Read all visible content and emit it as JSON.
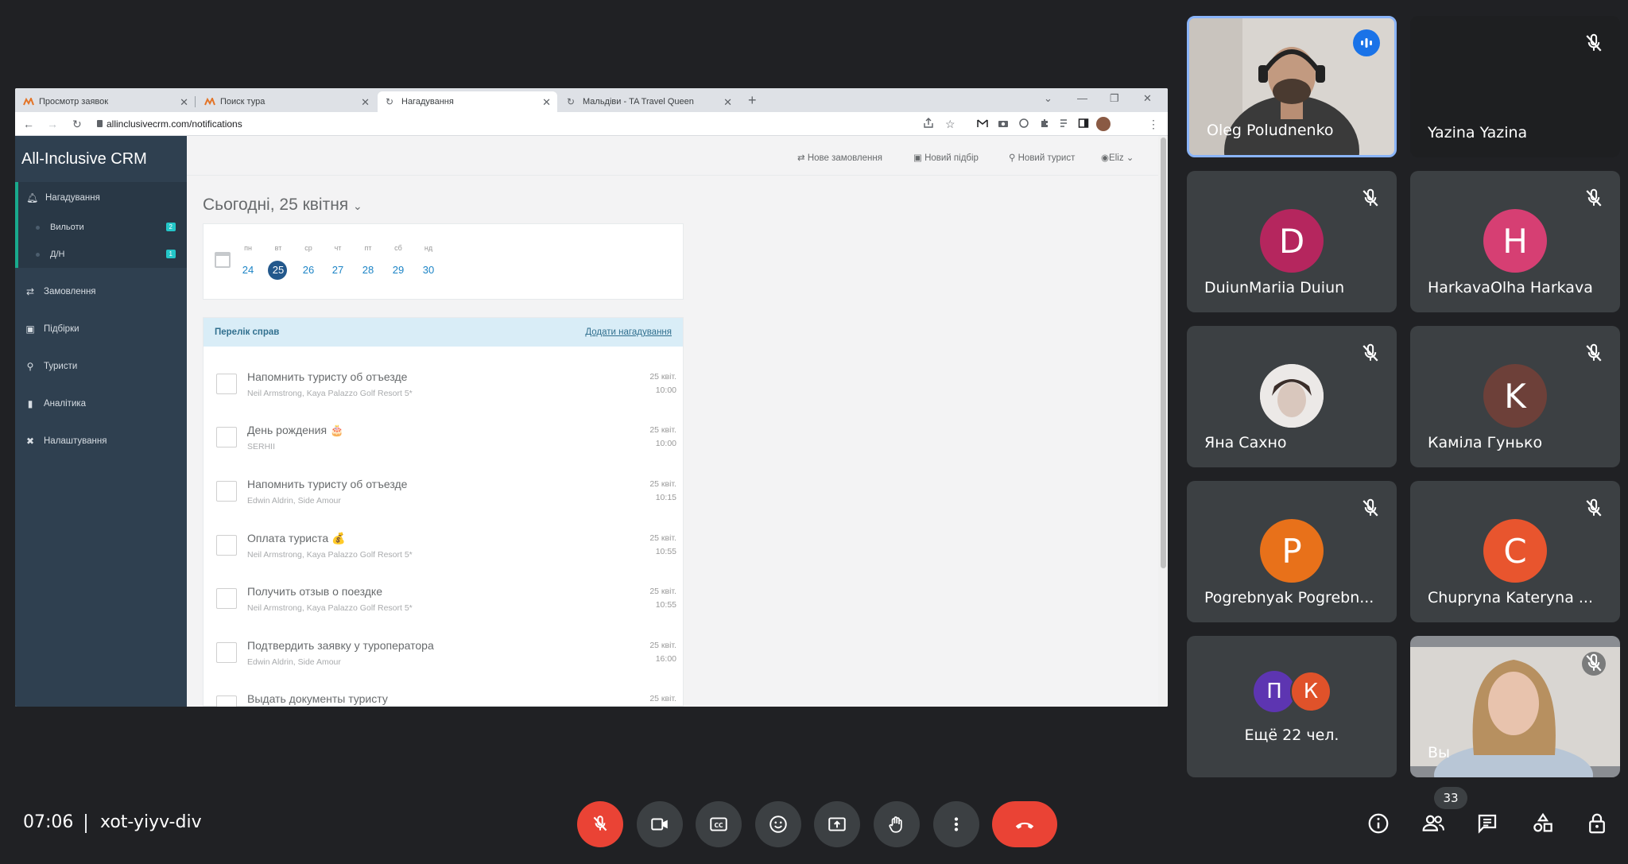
{
  "browser": {
    "tabs": [
      {
        "label": "Просмотр заявок"
      },
      {
        "label": "Поиск тура"
      },
      {
        "label": "Нагадування"
      },
      {
        "label": "Мальдіви - TA Travel Queen"
      }
    ],
    "url": "allinclusivecrm.com/notifications"
  },
  "app": {
    "brand": "All-Inclusive CRM",
    "sidebar": {
      "items": [
        {
          "label": "Нагадування",
          "icon": "bell-icon"
        },
        {
          "label": "Замовлення",
          "icon": "handshake-icon"
        },
        {
          "label": "Підбірки",
          "icon": "folder-icon"
        },
        {
          "label": "Туристи",
          "icon": "walker-icon"
        },
        {
          "label": "Аналітика",
          "icon": "bar-chart-icon"
        },
        {
          "label": "Налаштування",
          "icon": "tools-icon"
        }
      ],
      "subitems": [
        {
          "label": "Вильоти",
          "badge": "2"
        },
        {
          "label": "Д/Н",
          "badge": "1"
        }
      ]
    },
    "topnav": {
      "new_order": "Нове замовлення",
      "new_selection": "Новий підбір",
      "new_tourist": "Новий турист",
      "user": "Eliz"
    },
    "date_title": "Сьогодні, 25 квітня",
    "week": {
      "days": [
        "пн",
        "вт",
        "ср",
        "чт",
        "пт",
        "сб",
        "нд"
      ],
      "dates": [
        "24",
        "25",
        "26",
        "27",
        "28",
        "29",
        "30"
      ],
      "selected": "25"
    },
    "tasks_panel": {
      "title": "Перелік справ",
      "add_label": "Додати нагадування",
      "tasks": [
        {
          "title": "Напомнить туристу об отъезде",
          "sub": "Neil Armstrong, Kaya Palazzo Golf Resort 5*",
          "date": "25 квіт.",
          "time": "10:00"
        },
        {
          "title": "День рождения 🎂",
          "sub": "SERHII",
          "date": "25 квіт.",
          "time": "10:00"
        },
        {
          "title": "Напомнить туристу об отъезде",
          "sub": "Edwin Aldrin, Side Amour",
          "date": "25 квіт.",
          "time": "10:15"
        },
        {
          "title": "Оплата туриста 💰",
          "sub": "Neil Armstrong, Kaya Palazzo Golf Resort 5*",
          "date": "25 квіт.",
          "time": "10:55"
        },
        {
          "title": "Получить отзыв о поездке",
          "sub": "Neil Armstrong, Kaya Palazzo Golf Resort 5*",
          "date": "25 квіт.",
          "time": "10:55"
        },
        {
          "title": "Подтвердить заявку у туроператора",
          "sub": "Edwin Aldrin, Side Amour",
          "date": "25 квіт.",
          "time": "16:00"
        },
        {
          "title": "Выдать документы туристу",
          "sub": "",
          "date": "25 квіт.",
          "time": ""
        }
      ]
    }
  },
  "participants": [
    {
      "name": "Oleg Poludnenko",
      "type": "video",
      "speaking": true
    },
    {
      "name": "Yazina Yazina",
      "type": "blank",
      "muted": true
    },
    {
      "name": "DuiunMariia Duiun",
      "initial": "D",
      "color": "#b5265e",
      "muted": true
    },
    {
      "name": "HarkavaOlha Harkava",
      "initial": "H",
      "color": "#d63f73",
      "muted": true
    },
    {
      "name": "Яна Сахно",
      "type": "photo",
      "muted": true
    },
    {
      "name": "Каміла Гунько",
      "initial": "K",
      "color": "#6d4039",
      "muted": true
    },
    {
      "name": "Pogrebnyak Pogrebn...",
      "initial": "P",
      "color": "#e8711a",
      "muted": true
    },
    {
      "name": "Chupryna Kateryna ...",
      "initial": "C",
      "color": "#e8552e",
      "muted": true
    },
    {
      "name": "Ещё 22 чел.",
      "initials": [
        "П",
        "К"
      ],
      "colors": [
        "#5d35b1",
        "#e0522a"
      ]
    },
    {
      "name": "Вы",
      "type": "video",
      "muted": true
    }
  ],
  "meeting": {
    "time": "07:06",
    "code": "xot-yiyv-div",
    "participants_count": "33",
    "colors": {
      "end_call": "#ea4335",
      "active_border": "#8ab4f8"
    }
  }
}
